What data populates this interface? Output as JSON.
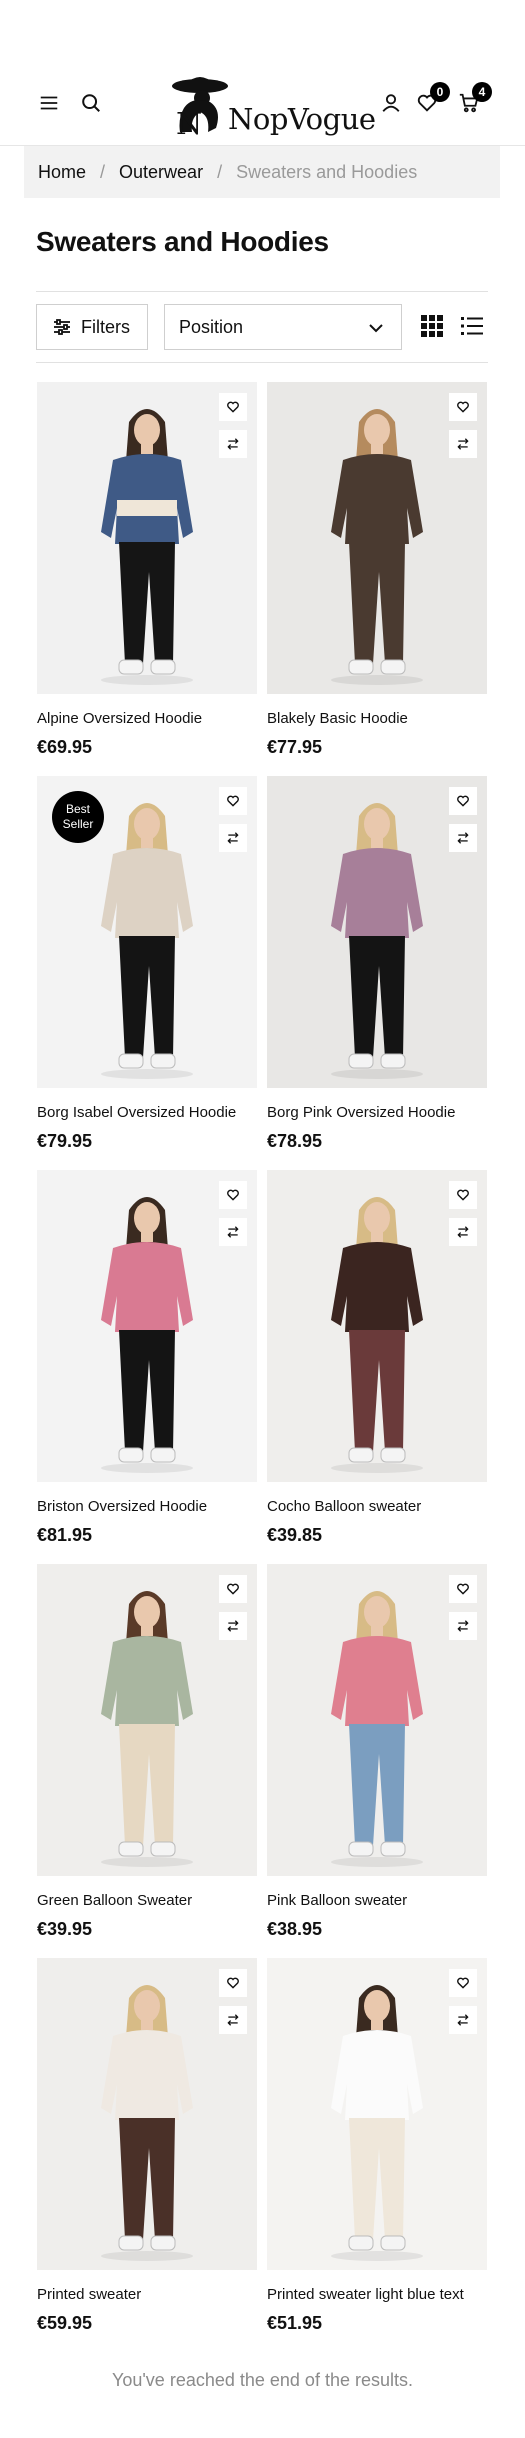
{
  "header": {
    "menu_icon": "hamburger-menu-icon",
    "search_icon": "search-icon",
    "logo_text": "NopVogue",
    "account_icon": "user-icon",
    "wishlist_count": "0",
    "cart_count": "4"
  },
  "breadcrumb": {
    "home": "Home",
    "sep1": "/",
    "category": "Outerwear",
    "sep2": "/",
    "current": "Sweaters and Hoodies"
  },
  "page_title": "Sweaters and Hoodies",
  "toolbar": {
    "filters_label": "Filters",
    "sort_selected": "Position"
  },
  "products": [
    {
      "name": "Alpine Oversized Hoodie",
      "price": "€69.95",
      "badge": "",
      "top": "#3f5a86",
      "top2": "#efe6d8",
      "bottom": "#151515",
      "bg": "#f1f1f1",
      "hair": "#3a2a20"
    },
    {
      "name": "Blakely Basic Hoodie",
      "price": "€77.95",
      "badge": "",
      "top": "#4a3a30",
      "top2": "#4a3a30",
      "bottom": "#4a3a30",
      "bg": "#e9e8e6",
      "hair": "#b58b5e"
    },
    {
      "name": "Borg Isabel Oversized Hoodie",
      "price": "€79.95",
      "badge": "Best Seller",
      "top": "#ddd2c4",
      "top2": "#ddd2c4",
      "bottom": "#141414",
      "bg": "#f3f3f3",
      "hair": "#d7bb86"
    },
    {
      "name": "Borg Pink Oversized Hoodie",
      "price": "€78.95",
      "badge": "",
      "top": "#a77f99",
      "top2": "#a77f99",
      "bottom": "#141414",
      "bg": "#e8e7e5",
      "hair": "#d7bb86"
    },
    {
      "name": "Briston Oversized Hoodie",
      "price": "€81.95",
      "badge": "",
      "top": "#d97a92",
      "top2": "#d97a92",
      "bottom": "#141414",
      "bg": "#f3f3f3",
      "hair": "#3a2a20"
    },
    {
      "name": "Cocho Balloon sweater",
      "price": "€39.85",
      "badge": "",
      "top": "#3b2520",
      "top2": "#3b2520",
      "bottom": "#6a3a3a",
      "bg": "#efeeec",
      "hair": "#d7bb86"
    },
    {
      "name": "Green Balloon Sweater",
      "price": "€39.95",
      "badge": "",
      "top": "#a9b6a0",
      "top2": "#a9b6a0",
      "bottom": "#e6d8c2",
      "bg": "#efeeec",
      "hair": "#5a3a28"
    },
    {
      "name": "Pink Balloon sweater",
      "price": "€38.95",
      "badge": "",
      "top": "#df7f8f",
      "top2": "#df7f8f",
      "bottom": "#7b9ec0",
      "bg": "#efeeec",
      "hair": "#d7bb86"
    },
    {
      "name": "Printed sweater",
      "price": "€59.95",
      "badge": "",
      "top": "#efe9e2",
      "top2": "#efe9e2",
      "bottom": "#4a3028",
      "bg": "#efeeec",
      "hair": "#d7bb86"
    },
    {
      "name": "Printed sweater light blue text",
      "price": "€51.95",
      "badge": "",
      "top": "#fbfbfb",
      "top2": "#fbfbfb",
      "bottom": "#efe7da",
      "bg": "#f4f3f1",
      "hair": "#3a2a20"
    }
  ],
  "end_message": "You've reached the end of the results."
}
